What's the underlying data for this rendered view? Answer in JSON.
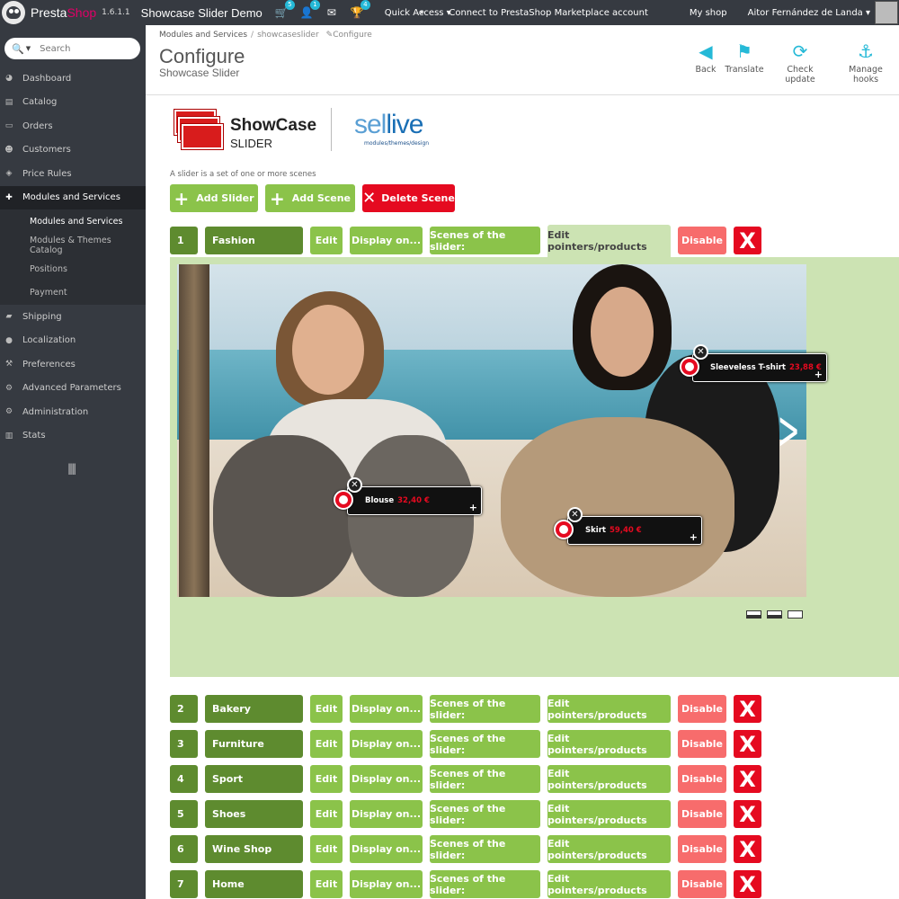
{
  "topbar": {
    "brand_presta": "Presta",
    "brand_shop": "Shop",
    "version": "1.6.1.1",
    "shop_name": "Showcase Slider Demo",
    "orders_badge": "5",
    "customers_badge": "1",
    "trophy_badge": "4",
    "quick_access": "Quick Access ▾",
    "connect": "Connect to PrestaShop Marketplace account",
    "my_shop": "My shop",
    "user": "Aitor Fernández de Landa ▾"
  },
  "sidebar": {
    "search_placeholder": "Search",
    "items": [
      {
        "label": "Dashboard",
        "icon": "dashboard-icon"
      },
      {
        "label": "Catalog",
        "icon": "catalog-icon"
      },
      {
        "label": "Orders",
        "icon": "orders-icon"
      },
      {
        "label": "Customers",
        "icon": "customers-icon"
      },
      {
        "label": "Price Rules",
        "icon": "price-rules-icon"
      },
      {
        "label": "Modules and Services",
        "icon": "puzzle-icon"
      }
    ],
    "subitems": [
      "Modules and Services",
      "Modules & Themes Catalog",
      "Positions",
      "Payment"
    ],
    "items2": [
      {
        "label": "Shipping",
        "icon": "truck-icon"
      },
      {
        "label": "Localization",
        "icon": "globe-icon"
      },
      {
        "label": "Preferences",
        "icon": "wrench-icon"
      },
      {
        "label": "Advanced Parameters",
        "icon": "cogs-icon"
      },
      {
        "label": "Administration",
        "icon": "cog-icon"
      },
      {
        "label": "Stats",
        "icon": "bar-chart-icon"
      }
    ]
  },
  "header": {
    "breadcrumb": [
      "Modules and Services",
      "showcaseslider",
      "Configure"
    ],
    "title": "Configure",
    "subtitle": "Showcase Slider",
    "toolbar": {
      "back": "Back",
      "translate": "Translate",
      "check_update": "Check update",
      "manage_hooks": "Manage hooks"
    }
  },
  "module": {
    "logo_title": "ShowCase",
    "logo_sub": "SLIDER",
    "partner_a": "sel",
    "partner_b": "live",
    "partner_sub": "modules/themes/design",
    "hint": "A slider is a set of one or more scenes",
    "add_slider": "Add Slider",
    "add_scene": "Add Scene",
    "delete_scene": "Delete Scene"
  },
  "row_labels": {
    "edit": "Edit",
    "display": "Display on...",
    "scenes": "Scenes of the slider:",
    "pointers": "Edit pointers/products",
    "disable": "Disable",
    "delete": "X"
  },
  "sliders": [
    {
      "num": "1",
      "name": "Fashion"
    },
    {
      "num": "2",
      "name": "Bakery"
    },
    {
      "num": "3",
      "name": "Furniture"
    },
    {
      "num": "4",
      "name": "Sport"
    },
    {
      "num": "5",
      "name": "Shoes"
    },
    {
      "num": "6",
      "name": "Wine Shop"
    },
    {
      "num": "7",
      "name": "Home"
    }
  ],
  "pointers": [
    {
      "name": "Sleeveless T-shirt",
      "price": "23,88 €"
    },
    {
      "name": "Blouse",
      "price": "32,40 €"
    },
    {
      "name": "Skirt",
      "price": "59,40 €"
    }
  ],
  "colors": {
    "green": "#8bc34a",
    "dark_green": "#5e8b2f",
    "red": "#e50a20",
    "light_red": "#f76c6c",
    "panel": "#cce3b3",
    "accent": "#25b9d7",
    "brand_pink": "#df0067"
  }
}
